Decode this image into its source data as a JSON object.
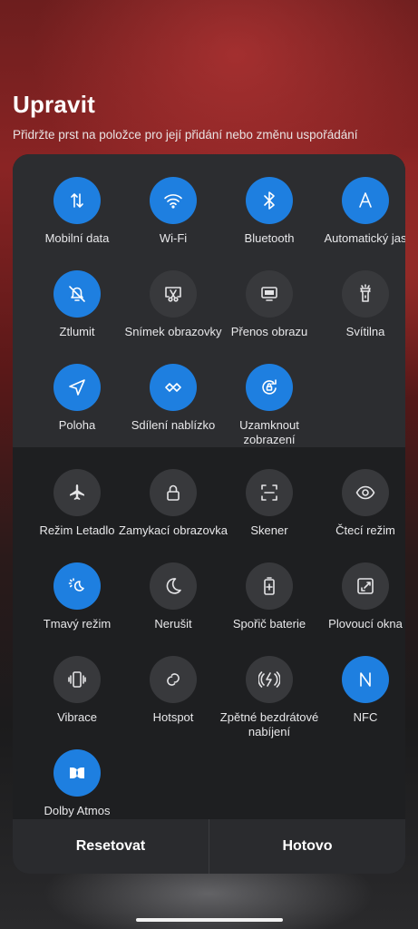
{
  "header": {
    "title": "Upravit",
    "subtitle": "Přidržte prst na položce pro její přidání nebo změnu uspořádání"
  },
  "active_tiles": [
    {
      "label": "Mobilní data",
      "icon": "mobile-data-icon",
      "on": true
    },
    {
      "label": "Wi-Fi",
      "icon": "wifi-icon",
      "on": true
    },
    {
      "label": "Bluetooth",
      "icon": "bluetooth-icon",
      "on": true
    },
    {
      "label": "Automatický jas",
      "icon": "auto-brightness-icon",
      "on": true
    },
    {
      "label": "Ztlumit",
      "icon": "mute-bell-icon",
      "on": true
    },
    {
      "label": "Snímek obrazovky",
      "icon": "screenshot-icon",
      "on": false
    },
    {
      "label": "Přenos obrazu",
      "icon": "screen-cast-icon",
      "on": false
    },
    {
      "label": "Svítilna",
      "icon": "flashlight-icon",
      "on": false
    },
    {
      "label": "Poloha",
      "icon": "location-icon",
      "on": true
    },
    {
      "label": "Sdílení nablízko",
      "icon": "nearby-share-icon",
      "on": true
    },
    {
      "label": "Uzamknout zobrazení",
      "icon": "rotation-lock-icon",
      "on": true
    }
  ],
  "available_tiles": [
    {
      "label": "Režim Letadlo",
      "icon": "airplane-icon",
      "on": false
    },
    {
      "label": "Zamykací obrazovka",
      "icon": "lock-icon",
      "on": false
    },
    {
      "label": "Skener",
      "icon": "scanner-icon",
      "on": false
    },
    {
      "label": "Čtecí režim",
      "icon": "eye-icon",
      "on": false
    },
    {
      "label": "Tmavý režim",
      "icon": "dark-mode-icon",
      "on": true
    },
    {
      "label": "Nerušit",
      "icon": "moon-icon",
      "on": false
    },
    {
      "label": "Spořič baterie",
      "icon": "battery-saver-icon",
      "on": false
    },
    {
      "label": "Plovoucí okna",
      "icon": "floating-window-icon",
      "on": false
    },
    {
      "label": "Vibrace",
      "icon": "vibration-icon",
      "on": false
    },
    {
      "label": "Hotspot",
      "icon": "hotspot-icon",
      "on": false
    },
    {
      "label": "Zpětné bezdrátové nabíjení",
      "icon": "reverse-charging-icon",
      "on": false
    },
    {
      "label": "NFC",
      "icon": "nfc-icon",
      "on": true
    },
    {
      "label": "Dolby Atmos",
      "icon": "dolby-icon",
      "on": true
    }
  ],
  "footer": {
    "reset_label": "Resetovat",
    "done_label": "Hotovo"
  },
  "colors": {
    "accent": "#1e7fe0",
    "tile_off": "#38393c"
  }
}
